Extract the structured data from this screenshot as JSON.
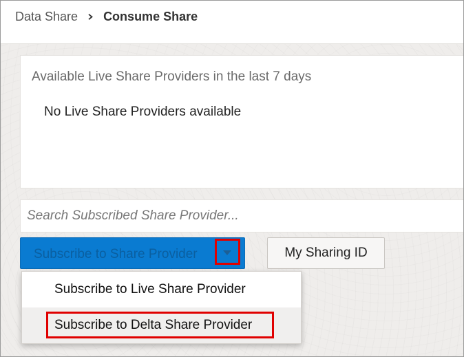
{
  "breadcrumb": {
    "root": "Data Share",
    "current": "Consume Share"
  },
  "panel": {
    "title": "Available Live Share Providers in the last 7 days",
    "empty_message": "No Live Share Providers available"
  },
  "search": {
    "placeholder": "Search Subscribed Share Provider..."
  },
  "actions": {
    "subscribe_label": "Subscribe to Share Provider",
    "my_sharing_id_label": "My Sharing ID"
  },
  "menu": {
    "items": [
      {
        "label": "Subscribe to Live Share Provider"
      },
      {
        "label": "Subscribe to Delta Share Provider"
      }
    ]
  },
  "colors": {
    "primary": "#0a7bd1",
    "highlight_annotation": "#e00000"
  }
}
